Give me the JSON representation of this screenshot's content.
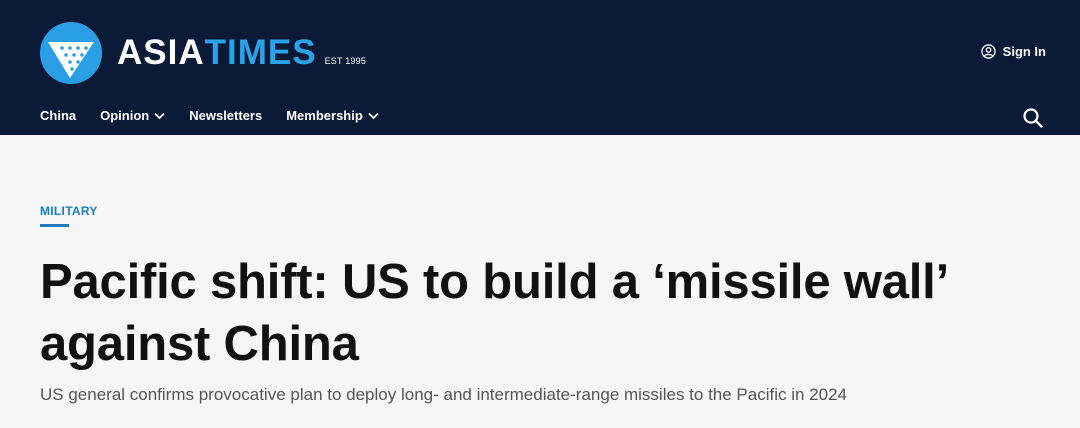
{
  "brand": {
    "name_part1": "ASIA",
    "name_part2": "TIMES",
    "established": "EST 1995",
    "logo_icon": "asia-times-logo-icon"
  },
  "account": {
    "signin_label": "Sign In",
    "icon": "user-circle-icon"
  },
  "nav": {
    "items": [
      {
        "label": "China",
        "has_dropdown": false
      },
      {
        "label": "Opinion",
        "has_dropdown": true
      },
      {
        "label": "Newsletters",
        "has_dropdown": false
      },
      {
        "label": "Membership",
        "has_dropdown": true
      }
    ],
    "search_icon": "search-icon"
  },
  "article": {
    "category": "MILITARY",
    "headline": "Pacific shift: US to build a ‘missile wall’ against China",
    "subheadline": "US general confirms provocative plan to deploy long- and intermediate-range missiles to the Pacific in 2024"
  },
  "colors": {
    "header_bg": "#0b1a37",
    "brand_blue": "#2aa3ea",
    "category_blue": "#1a7dc4",
    "page_bg": "#f6f6f6",
    "headline": "#111111"
  }
}
